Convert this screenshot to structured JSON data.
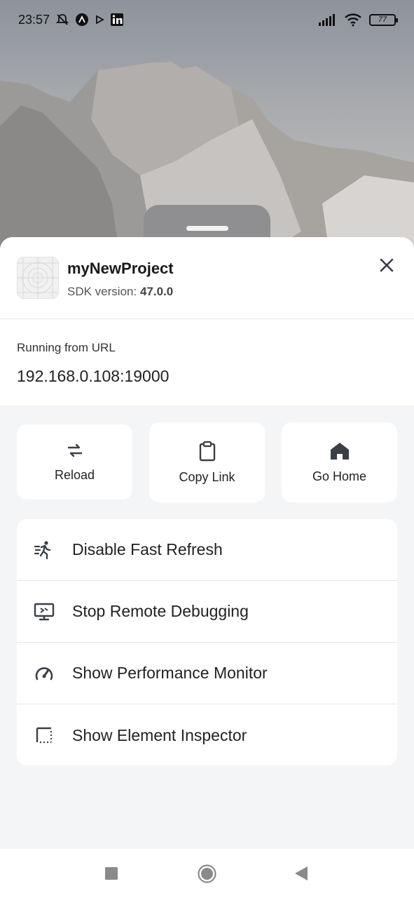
{
  "status_bar": {
    "time": "23:57",
    "battery": "77",
    "icons": [
      "bell-off-icon",
      "app-a-icon",
      "play-icon",
      "linkedin-icon",
      "signal-icon",
      "wifi-icon",
      "battery-icon"
    ]
  },
  "project": {
    "name": "myNewProject",
    "sdk_label": "SDK version:",
    "sdk_version": "47.0.0"
  },
  "url": {
    "label": "Running from URL",
    "value": "192.168.0.108:19000"
  },
  "actions": [
    {
      "label": "Reload",
      "icon": "reload-icon"
    },
    {
      "label": "Copy Link",
      "icon": "clipboard-icon"
    },
    {
      "label": "Go Home",
      "icon": "home-icon"
    }
  ],
  "menu": [
    {
      "label": "Disable Fast Refresh",
      "icon": "running-person-icon"
    },
    {
      "label": "Stop Remote Debugging",
      "icon": "monitor-debug-icon"
    },
    {
      "label": "Show Performance Monitor",
      "icon": "speedometer-icon"
    },
    {
      "label": "Show Element Inspector",
      "icon": "inspector-icon"
    }
  ],
  "nav": [
    "recents-square-icon",
    "home-circle-icon",
    "back-triangle-icon"
  ],
  "colors": {
    "sheet_bg": "#f4f5f7",
    "card_bg": "#ffffff",
    "icon": "#3a3f47"
  }
}
